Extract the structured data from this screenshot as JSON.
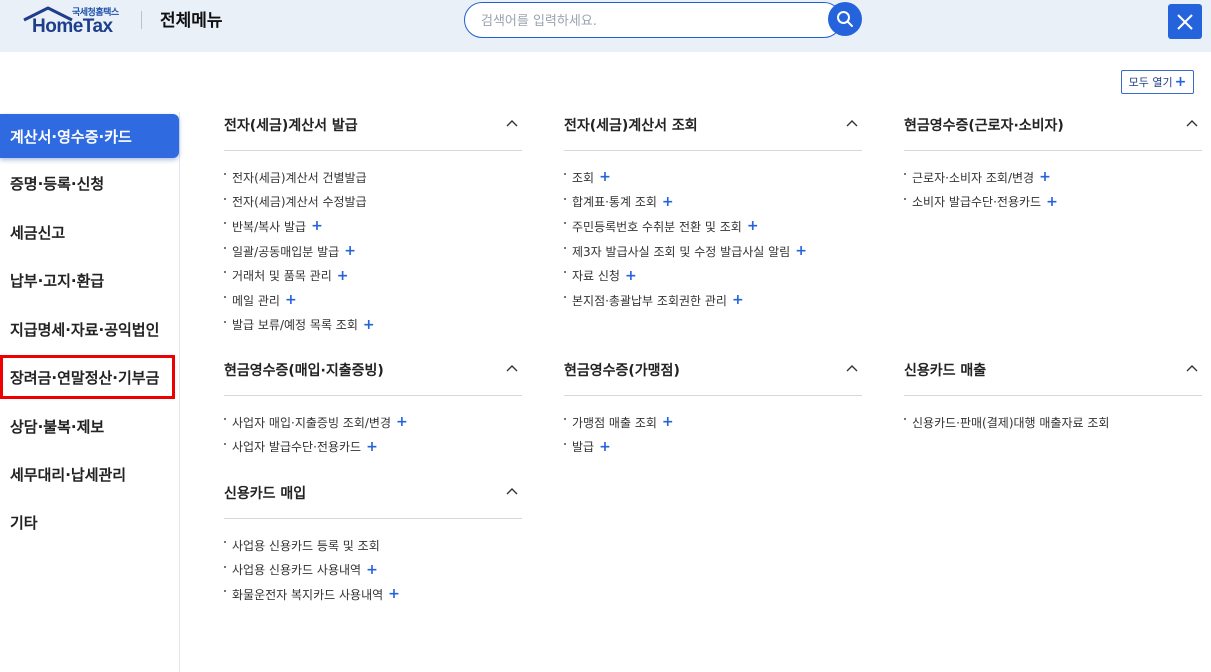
{
  "header": {
    "logo_small": "국세청홈택스",
    "logo_main": "HomeTax",
    "title": "전체메뉴",
    "search_placeholder": "검색어를 입력하세요."
  },
  "expand_all_label": "모두 열기",
  "sidebar": [
    {
      "label": "계산서·영수증·카드",
      "state": "active"
    },
    {
      "label": "증명·등록·신청"
    },
    {
      "label": "세금신고"
    },
    {
      "label": "납부·고지·환급"
    },
    {
      "label": "지급명세·자료·공익법인"
    },
    {
      "label": "장려금·연말정산·기부금",
      "state": "highlight"
    },
    {
      "label": "상담·불복·제보"
    },
    {
      "label": "세무대리·납세관리"
    },
    {
      "label": "기타"
    }
  ],
  "sections": [
    {
      "title": "전자(세금)계산서 발급",
      "items": [
        {
          "label": "전자(세금)계산서 건별발급",
          "plus": false
        },
        {
          "label": "전자(세금)계산서 수정발급",
          "plus": false
        },
        {
          "label": "반복/복사 발급",
          "plus": true
        },
        {
          "label": "일괄/공동매입분 발급",
          "plus": true
        },
        {
          "label": "거래처 및 품목 관리",
          "plus": true
        },
        {
          "label": "메일 관리",
          "plus": true
        },
        {
          "label": "발급 보류/예정 목록 조회",
          "plus": true
        }
      ]
    },
    {
      "title": "전자(세금)계산서 조회",
      "items": [
        {
          "label": "조회",
          "plus": true
        },
        {
          "label": "합계표·통계 조회",
          "plus": true
        },
        {
          "label": "주민등록번호 수취분 전환 및 조회",
          "plus": true
        },
        {
          "label": "제3자 발급사실 조회 및 수정 발급사실 알림",
          "plus": true
        },
        {
          "label": "자료 신청",
          "plus": true
        },
        {
          "label": "본지점·총괄납부 조회권한 관리",
          "plus": true
        }
      ]
    },
    {
      "title": "현금영수증(근로자·소비자)",
      "items": [
        {
          "label": "근로자·소비자 조회/변경",
          "plus": true
        },
        {
          "label": "소비자 발급수단·전용카드",
          "plus": true
        }
      ]
    },
    {
      "title": "현금영수증(매입·지출증빙)",
      "items": [
        {
          "label": "사업자 매입·지출증빙 조회/변경",
          "plus": true
        },
        {
          "label": "사업자 발급수단·전용카드",
          "plus": true
        }
      ]
    },
    {
      "title": "현금영수증(가맹점)",
      "items": [
        {
          "label": "가맹점 매출 조회",
          "plus": true
        },
        {
          "label": "발급",
          "plus": true
        }
      ]
    },
    {
      "title": "신용카드 매출",
      "items": [
        {
          "label": "신용카드·판매(결제)대행 매출자료 조회",
          "plus": false
        }
      ]
    },
    {
      "title": "신용카드 매입",
      "items": [
        {
          "label": "사업용 신용카드 등록 및 조회",
          "plus": false
        },
        {
          "label": "사업용 신용카드 사용내역",
          "plus": true
        },
        {
          "label": "화물운전자 복지카드 사용내역",
          "plus": true
        }
      ]
    }
  ],
  "icons": {
    "search": "search-icon",
    "close": "close-icon",
    "collapse": "chevron-up-icon",
    "expand": "plus-icon"
  },
  "colors": {
    "brand_blue": "#2563dc",
    "active_menu": "#2f6ae0",
    "highlight_border": "#ee0000",
    "header_bg": "#eaf0f8"
  }
}
